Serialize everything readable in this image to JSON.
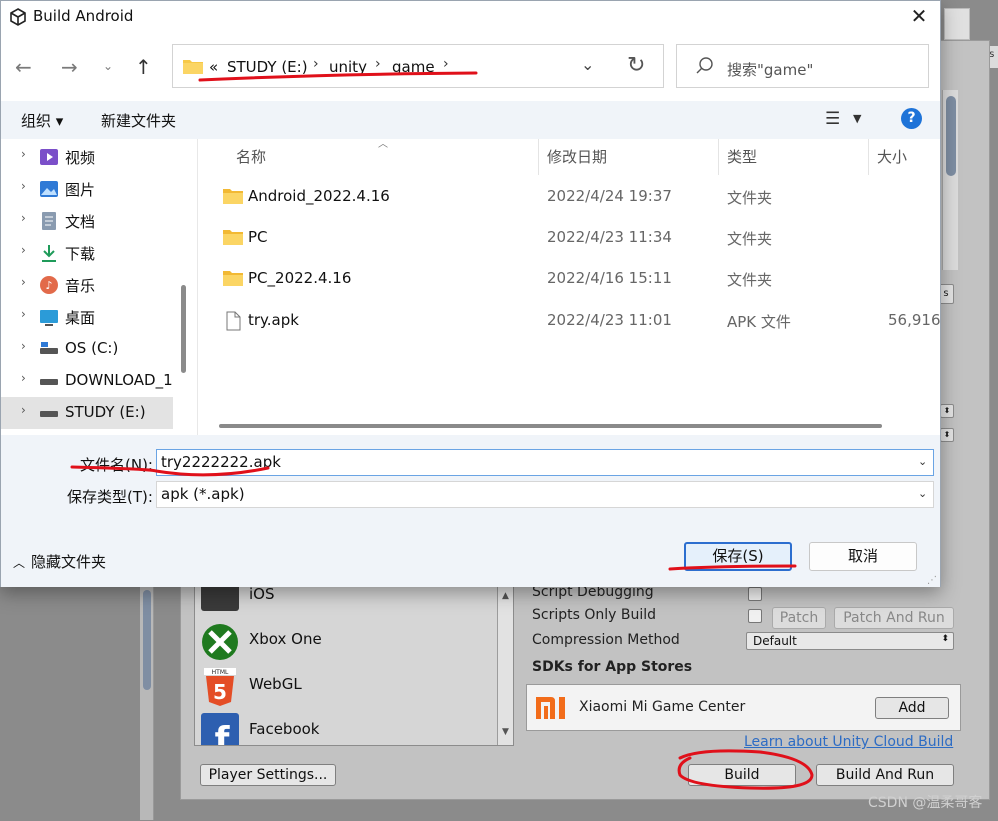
{
  "dialog": {
    "title": "Build Android",
    "close_glyph": "✕",
    "address": {
      "overflow": "«",
      "crumbs": [
        "STUDY (E:)",
        "unity",
        "game"
      ],
      "sep": "›"
    },
    "search_placeholder": "搜索\"game\"",
    "toolbar": {
      "organize": "组织 ▾",
      "new_folder": "新建文件夹",
      "help": "?"
    },
    "nav_items": [
      {
        "label": "视频",
        "icon": "video-icon"
      },
      {
        "label": "图片",
        "icon": "pictures-icon"
      },
      {
        "label": "文档",
        "icon": "documents-icon"
      },
      {
        "label": "下载",
        "icon": "download-icon"
      },
      {
        "label": "音乐",
        "icon": "music-icon"
      },
      {
        "label": "桌面",
        "icon": "desktop-icon"
      },
      {
        "label": "OS (C:)",
        "icon": "drive-icon"
      },
      {
        "label": "DOWNLOAD_1",
        "icon": "drive-icon"
      },
      {
        "label": "STUDY (E:)",
        "icon": "drive-icon"
      }
    ],
    "columns": {
      "name": "名称",
      "modified": "修改日期",
      "type": "类型",
      "size": "大小"
    },
    "files": [
      {
        "name": "Android_2022.4.16",
        "modified": "2022/4/24 19:37",
        "type": "文件夹",
        "size": "",
        "kind": "folder"
      },
      {
        "name": "PC",
        "modified": "2022/4/23 11:34",
        "type": "文件夹",
        "size": "",
        "kind": "folder"
      },
      {
        "name": "PC_2022.4.16",
        "modified": "2022/4/16 15:11",
        "type": "文件夹",
        "size": "",
        "kind": "folder"
      },
      {
        "name": "try.apk",
        "modified": "2022/4/23 11:01",
        "type": "APK 文件",
        "size": "56,916",
        "kind": "file"
      }
    ],
    "filename_label": "文件名(N):",
    "filename_value": "try2222222.apk",
    "filetype_label": "保存类型(T):",
    "filetype_value": "apk (*.apk)",
    "hide_folders": "隐藏文件夹",
    "save_label": "保存(S)",
    "cancel_label": "取消"
  },
  "unity": {
    "gizmos_tab": "zmos",
    "platforms": [
      {
        "label": "iOS",
        "icon": "ios-icon"
      },
      {
        "label": "Xbox One",
        "icon": "xbox-icon"
      },
      {
        "label": "WebGL",
        "icon": "html5-icon"
      },
      {
        "label": "Facebook",
        "icon": "facebook-icon"
      }
    ],
    "settings": {
      "script_debugging": "Script Debugging",
      "scripts_only_build": "Scripts Only Build",
      "compression_method": "Compression Method",
      "compression_value": "Default",
      "patch": "Patch",
      "patch_and_run": "Patch And Run",
      "sdks_title": "SDKs for App Stores",
      "sdk_name": "Xiaomi Mi Game Center",
      "add": "Add",
      "learn_link": "Learn about Unity Cloud Build",
      "player_settings": "Player Settings...",
      "build": "Build",
      "build_and_run": "Build And Run"
    },
    "watermark": "CSDN @温柔哥客"
  },
  "colors": {
    "accent": "#1e73d8",
    "annotation": "#e0101a",
    "folder": "#f7c948"
  }
}
